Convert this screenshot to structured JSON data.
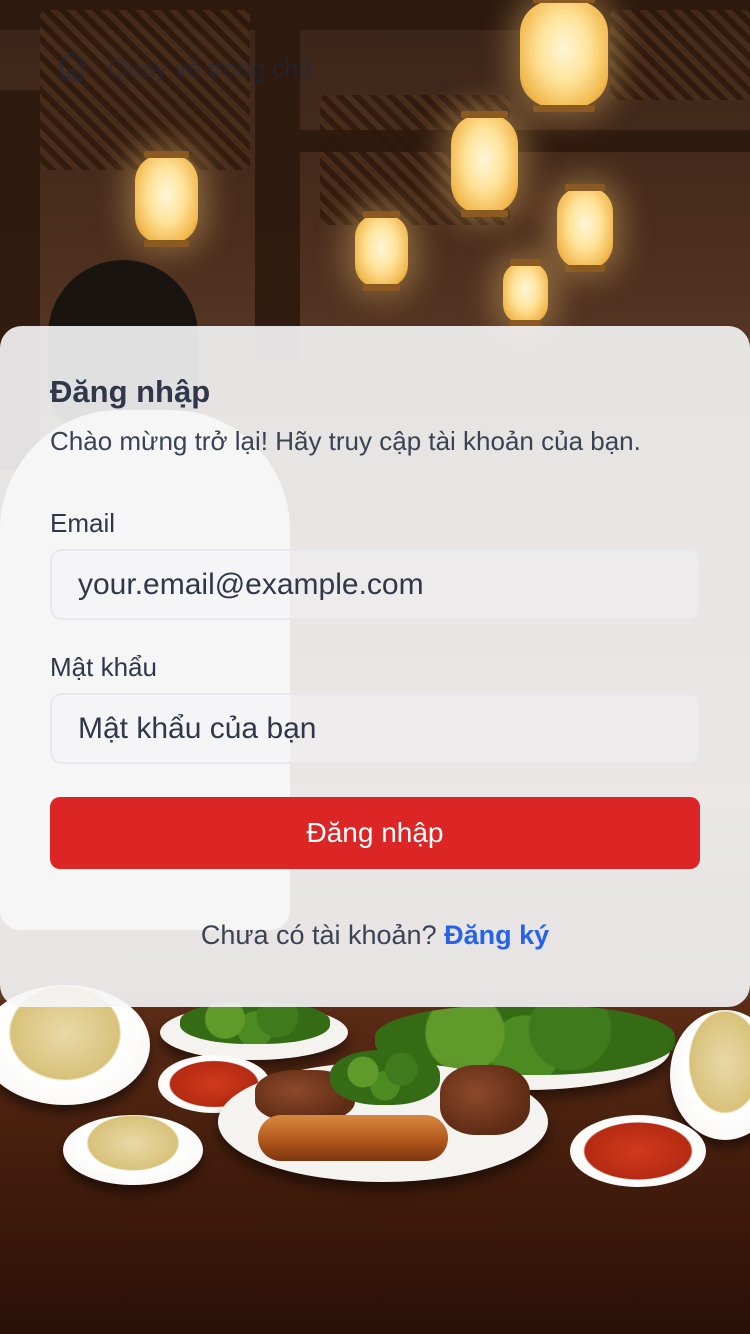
{
  "nav": {
    "back_label": "Quay về trang chủ",
    "back_icon": "home-icon"
  },
  "login": {
    "title": "Đăng nhập",
    "subtitle": "Chào mừng trở lại! Hãy truy cập tài khoản của bạn.",
    "email_label": "Email",
    "email_placeholder": "your.email@example.com",
    "password_label": "Mật khẩu",
    "password_placeholder": "Mật khẩu của bạn",
    "submit_label": "Đăng nhập",
    "signup_prompt": "Chưa có tài khoản?",
    "signup_link": "Đăng ký"
  },
  "colors": {
    "primary_button": "#dc2626",
    "link": "#2563eb",
    "text": "#2f3748"
  }
}
